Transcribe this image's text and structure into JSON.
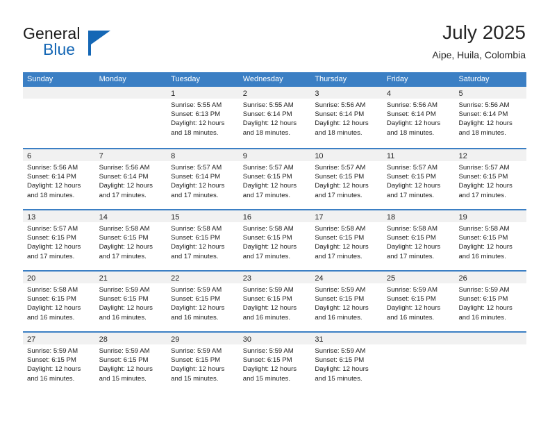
{
  "brand": {
    "word1": "General",
    "word2": "Blue",
    "logo_color": "#1567b5"
  },
  "header": {
    "title": "July 2025",
    "subtitle": "Aipe, Huila, Colombia"
  },
  "theme": {
    "header_blue": "#3b7fc4",
    "datebar_gray": "#f1f1f1",
    "text": "#1c1c1c"
  },
  "weekdays": [
    "Sunday",
    "Monday",
    "Tuesday",
    "Wednesday",
    "Thursday",
    "Friday",
    "Saturday"
  ],
  "weeks": [
    [
      {
        "day": "",
        "sunrise": "",
        "sunset": "",
        "daylight1": "",
        "daylight2": ""
      },
      {
        "day": "",
        "sunrise": "",
        "sunset": "",
        "daylight1": "",
        "daylight2": ""
      },
      {
        "day": "1",
        "sunrise": "Sunrise: 5:55 AM",
        "sunset": "Sunset: 6:13 PM",
        "daylight1": "Daylight: 12 hours",
        "daylight2": "and 18 minutes."
      },
      {
        "day": "2",
        "sunrise": "Sunrise: 5:55 AM",
        "sunset": "Sunset: 6:14 PM",
        "daylight1": "Daylight: 12 hours",
        "daylight2": "and 18 minutes."
      },
      {
        "day": "3",
        "sunrise": "Sunrise: 5:56 AM",
        "sunset": "Sunset: 6:14 PM",
        "daylight1": "Daylight: 12 hours",
        "daylight2": "and 18 minutes."
      },
      {
        "day": "4",
        "sunrise": "Sunrise: 5:56 AM",
        "sunset": "Sunset: 6:14 PM",
        "daylight1": "Daylight: 12 hours",
        "daylight2": "and 18 minutes."
      },
      {
        "day": "5",
        "sunrise": "Sunrise: 5:56 AM",
        "sunset": "Sunset: 6:14 PM",
        "daylight1": "Daylight: 12 hours",
        "daylight2": "and 18 minutes."
      }
    ],
    [
      {
        "day": "6",
        "sunrise": "Sunrise: 5:56 AM",
        "sunset": "Sunset: 6:14 PM",
        "daylight1": "Daylight: 12 hours",
        "daylight2": "and 18 minutes."
      },
      {
        "day": "7",
        "sunrise": "Sunrise: 5:56 AM",
        "sunset": "Sunset: 6:14 PM",
        "daylight1": "Daylight: 12 hours",
        "daylight2": "and 17 minutes."
      },
      {
        "day": "8",
        "sunrise": "Sunrise: 5:57 AM",
        "sunset": "Sunset: 6:14 PM",
        "daylight1": "Daylight: 12 hours",
        "daylight2": "and 17 minutes."
      },
      {
        "day": "9",
        "sunrise": "Sunrise: 5:57 AM",
        "sunset": "Sunset: 6:15 PM",
        "daylight1": "Daylight: 12 hours",
        "daylight2": "and 17 minutes."
      },
      {
        "day": "10",
        "sunrise": "Sunrise: 5:57 AM",
        "sunset": "Sunset: 6:15 PM",
        "daylight1": "Daylight: 12 hours",
        "daylight2": "and 17 minutes."
      },
      {
        "day": "11",
        "sunrise": "Sunrise: 5:57 AM",
        "sunset": "Sunset: 6:15 PM",
        "daylight1": "Daylight: 12 hours",
        "daylight2": "and 17 minutes."
      },
      {
        "day": "12",
        "sunrise": "Sunrise: 5:57 AM",
        "sunset": "Sunset: 6:15 PM",
        "daylight1": "Daylight: 12 hours",
        "daylight2": "and 17 minutes."
      }
    ],
    [
      {
        "day": "13",
        "sunrise": "Sunrise: 5:57 AM",
        "sunset": "Sunset: 6:15 PM",
        "daylight1": "Daylight: 12 hours",
        "daylight2": "and 17 minutes."
      },
      {
        "day": "14",
        "sunrise": "Sunrise: 5:58 AM",
        "sunset": "Sunset: 6:15 PM",
        "daylight1": "Daylight: 12 hours",
        "daylight2": "and 17 minutes."
      },
      {
        "day": "15",
        "sunrise": "Sunrise: 5:58 AM",
        "sunset": "Sunset: 6:15 PM",
        "daylight1": "Daylight: 12 hours",
        "daylight2": "and 17 minutes."
      },
      {
        "day": "16",
        "sunrise": "Sunrise: 5:58 AM",
        "sunset": "Sunset: 6:15 PM",
        "daylight1": "Daylight: 12 hours",
        "daylight2": "and 17 minutes."
      },
      {
        "day": "17",
        "sunrise": "Sunrise: 5:58 AM",
        "sunset": "Sunset: 6:15 PM",
        "daylight1": "Daylight: 12 hours",
        "daylight2": "and 17 minutes."
      },
      {
        "day": "18",
        "sunrise": "Sunrise: 5:58 AM",
        "sunset": "Sunset: 6:15 PM",
        "daylight1": "Daylight: 12 hours",
        "daylight2": "and 17 minutes."
      },
      {
        "day": "19",
        "sunrise": "Sunrise: 5:58 AM",
        "sunset": "Sunset: 6:15 PM",
        "daylight1": "Daylight: 12 hours",
        "daylight2": "and 16 minutes."
      }
    ],
    [
      {
        "day": "20",
        "sunrise": "Sunrise: 5:58 AM",
        "sunset": "Sunset: 6:15 PM",
        "daylight1": "Daylight: 12 hours",
        "daylight2": "and 16 minutes."
      },
      {
        "day": "21",
        "sunrise": "Sunrise: 5:59 AM",
        "sunset": "Sunset: 6:15 PM",
        "daylight1": "Daylight: 12 hours",
        "daylight2": "and 16 minutes."
      },
      {
        "day": "22",
        "sunrise": "Sunrise: 5:59 AM",
        "sunset": "Sunset: 6:15 PM",
        "daylight1": "Daylight: 12 hours",
        "daylight2": "and 16 minutes."
      },
      {
        "day": "23",
        "sunrise": "Sunrise: 5:59 AM",
        "sunset": "Sunset: 6:15 PM",
        "daylight1": "Daylight: 12 hours",
        "daylight2": "and 16 minutes."
      },
      {
        "day": "24",
        "sunrise": "Sunrise: 5:59 AM",
        "sunset": "Sunset: 6:15 PM",
        "daylight1": "Daylight: 12 hours",
        "daylight2": "and 16 minutes."
      },
      {
        "day": "25",
        "sunrise": "Sunrise: 5:59 AM",
        "sunset": "Sunset: 6:15 PM",
        "daylight1": "Daylight: 12 hours",
        "daylight2": "and 16 minutes."
      },
      {
        "day": "26",
        "sunrise": "Sunrise: 5:59 AM",
        "sunset": "Sunset: 6:15 PM",
        "daylight1": "Daylight: 12 hours",
        "daylight2": "and 16 minutes."
      }
    ],
    [
      {
        "day": "27",
        "sunrise": "Sunrise: 5:59 AM",
        "sunset": "Sunset: 6:15 PM",
        "daylight1": "Daylight: 12 hours",
        "daylight2": "and 16 minutes."
      },
      {
        "day": "28",
        "sunrise": "Sunrise: 5:59 AM",
        "sunset": "Sunset: 6:15 PM",
        "daylight1": "Daylight: 12 hours",
        "daylight2": "and 15 minutes."
      },
      {
        "day": "29",
        "sunrise": "Sunrise: 5:59 AM",
        "sunset": "Sunset: 6:15 PM",
        "daylight1": "Daylight: 12 hours",
        "daylight2": "and 15 minutes."
      },
      {
        "day": "30",
        "sunrise": "Sunrise: 5:59 AM",
        "sunset": "Sunset: 6:15 PM",
        "daylight1": "Daylight: 12 hours",
        "daylight2": "and 15 minutes."
      },
      {
        "day": "31",
        "sunrise": "Sunrise: 5:59 AM",
        "sunset": "Sunset: 6:15 PM",
        "daylight1": "Daylight: 12 hours",
        "daylight2": "and 15 minutes."
      },
      {
        "day": "",
        "sunrise": "",
        "sunset": "",
        "daylight1": "",
        "daylight2": ""
      },
      {
        "day": "",
        "sunrise": "",
        "sunset": "",
        "daylight1": "",
        "daylight2": ""
      }
    ]
  ]
}
